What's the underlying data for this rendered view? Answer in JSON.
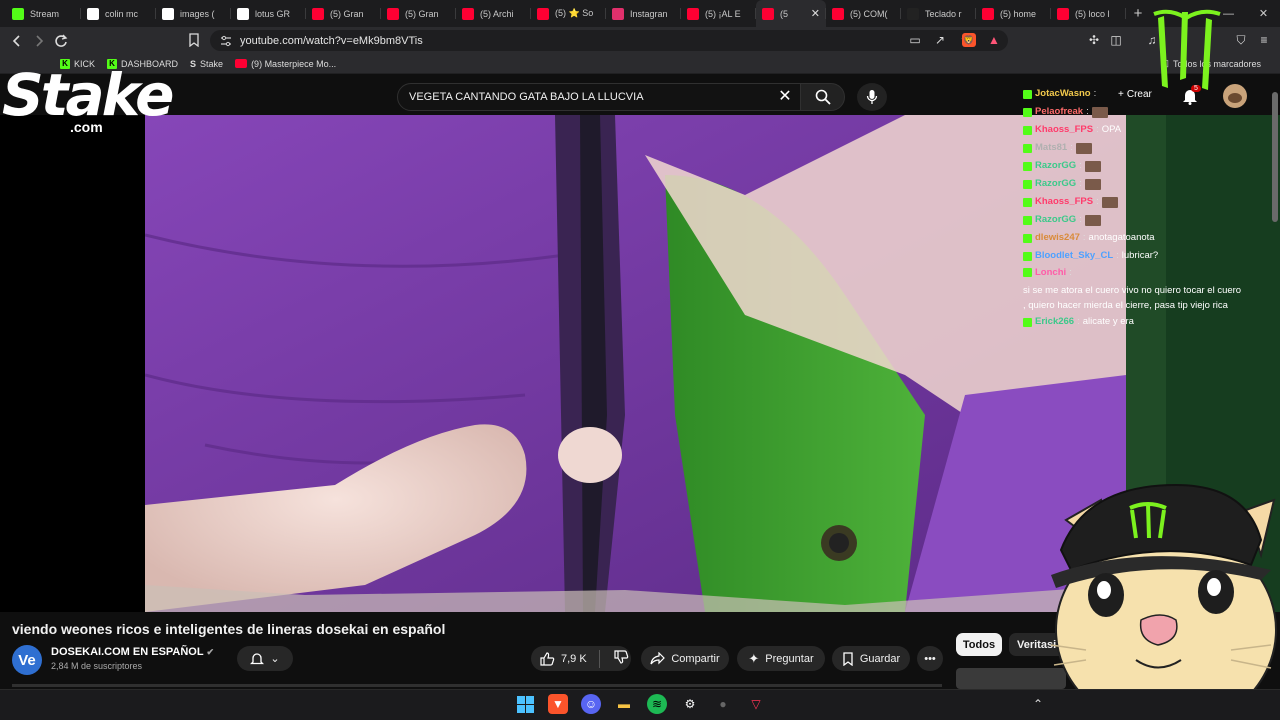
{
  "browser": {
    "tabs": [
      {
        "label": "Stream",
        "color": "#53fc18"
      },
      {
        "label": "colin mc",
        "color": "#ffffff"
      },
      {
        "label": "images (",
        "color": "#ffffff"
      },
      {
        "label": "lotus GR",
        "color": "#ffffff"
      },
      {
        "label": "(5) Gran",
        "color": "#ff0033"
      },
      {
        "label": "(5) Gran",
        "color": "#ff0033"
      },
      {
        "label": "(5) Archi",
        "color": "#ff0033"
      },
      {
        "label": "(5) ⭐ So",
        "color": "#ff0033"
      },
      {
        "label": "Instagran",
        "color": "#e1306c"
      },
      {
        "label": "(5) ¡AL E",
        "color": "#ff0033"
      },
      {
        "label": "(5",
        "color": "#ff0033",
        "active": true
      },
      {
        "label": "(5) COM(",
        "color": "#ff0033"
      },
      {
        "label": "Teclado r",
        "color": "#222222"
      },
      {
        "label": "(5) home",
        "color": "#ff0033"
      },
      {
        "label": "(5) loco l",
        "color": "#ff0033"
      }
    ],
    "url": "youtube.com/watch?v=eMk9bm8VTis",
    "bookmarks": [
      {
        "label": "KICK",
        "icon": "kick-icon"
      },
      {
        "label": "DASHBOARD",
        "icon": "kick-icon"
      },
      {
        "label": "Stake",
        "icon": "stake-icon"
      },
      {
        "label": "(9) Masterpiece Mo...",
        "icon": "youtube-icon"
      }
    ],
    "all_bookmarks_label": "Todos los marcadores"
  },
  "youtube": {
    "search_value": "VEGETA CANTANDO GATA BAJO LA LLUCVIA",
    "header_create_label": "Crear",
    "notification_count": "5",
    "video_title": "viendo weones ricos e inteligentes de lineras dosekai en español",
    "channel": {
      "avatar_text": "Ve",
      "name": "DOSEKAI.COM  EN ESPAÑOL",
      "subscribers": "2,84 M de suscriptores"
    },
    "actions": {
      "likes": "7,9 K",
      "share": "Compartir",
      "ask": "Preguntar",
      "save": "Guardar"
    },
    "chips": {
      "all": "Todos",
      "second": "Veritasiu"
    }
  },
  "chat": [
    {
      "user": "JotacWasno",
      "msg": "",
      "color": "#f2c94c",
      "emote": false
    },
    {
      "user": "Pelaofreak",
      "msg": "",
      "color": "#ff6b6b",
      "emote": true
    },
    {
      "user": "Khaoss_FPS",
      "msg": "OPA",
      "color": "#ff3b6b",
      "emote": false
    },
    {
      "user": "Mats81",
      "msg": "",
      "color": "#b0b0b0",
      "emote": true
    },
    {
      "user": "RazorGG",
      "msg": "",
      "color": "#3cc98a",
      "emote": true
    },
    {
      "user": "RazorGG",
      "msg": "",
      "color": "#3cc98a",
      "emote": true
    },
    {
      "user": "Khaoss_FPS",
      "msg": "",
      "color": "#ff3b6b",
      "emote": true
    },
    {
      "user": "RazorGG",
      "msg": "",
      "color": "#3cc98a",
      "emote": true
    },
    {
      "user": "dlewis247",
      "msg": "anotagatoanota",
      "color": "#d98b3a",
      "emote": false
    },
    {
      "user": "Bloodlet_Sky_CL",
      "msg": "lubricar?",
      "color": "#4ea1ff",
      "emote": false
    },
    {
      "user": "Lonchi",
      "msg": "si se me atora el cuero vivo no quiero tocar el cuero , quiero hacer mierda el cierre, pasa tip viejo rica",
      "color": "#ff5ca8",
      "emote": false
    },
    {
      "user": "Erick266",
      "msg": "alicate y era",
      "color": "#3cc98a",
      "emote": false
    }
  ],
  "overlays": {
    "stake_logo": "Stake",
    "stake_com": ".com"
  },
  "colors": {
    "kick_green": "#53fc18",
    "youtube_red": "#ff0033",
    "jacket_purple": "#7c3fa9",
    "jacket_green": "#3b9a2a"
  }
}
